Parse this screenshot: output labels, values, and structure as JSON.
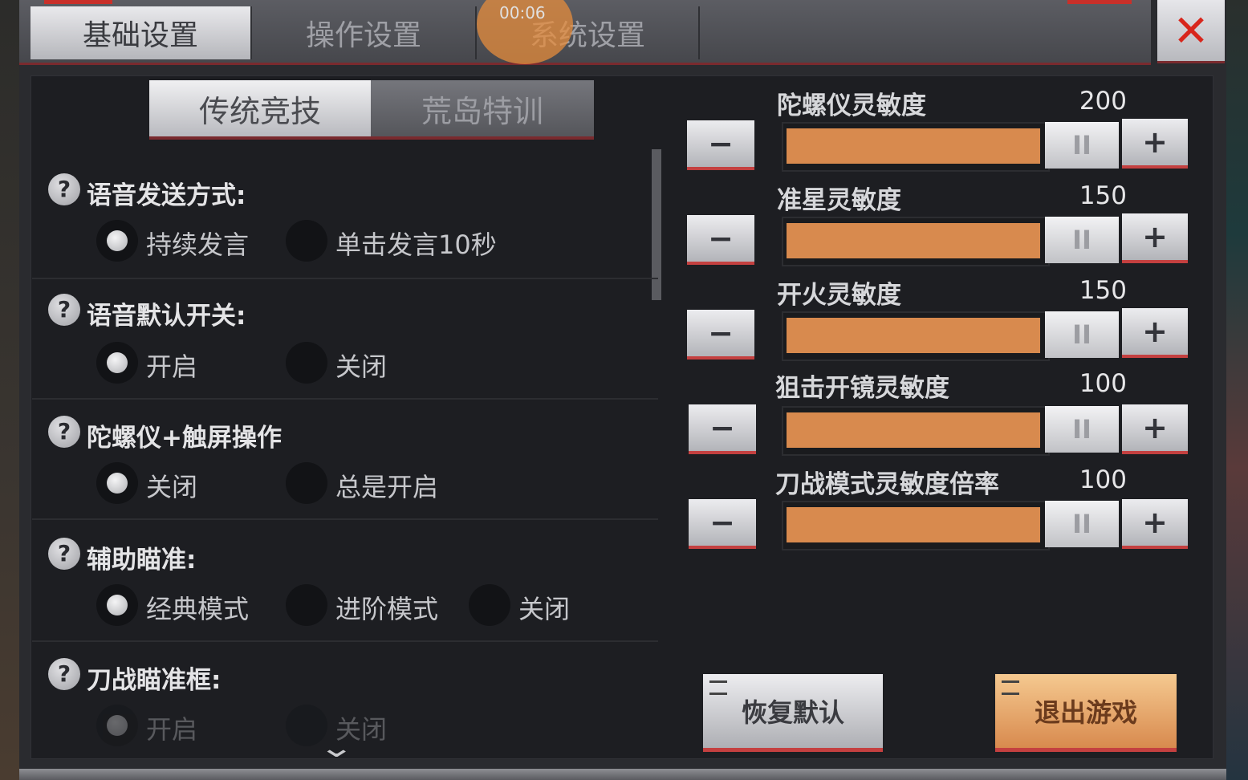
{
  "top_tabs": [
    {
      "label": "基础设置",
      "active": true
    },
    {
      "label": "操作设置",
      "active": false
    },
    {
      "label": "系统设置",
      "active": false
    }
  ],
  "timer": "00:06",
  "sub_tabs": [
    {
      "label": "传统竞技",
      "active": true
    },
    {
      "label": "荒岛特训",
      "active": false
    }
  ],
  "sections": [
    {
      "title": "语音发送方式:",
      "options": [
        "持续发言",
        "单击发言10秒"
      ],
      "selected": 0
    },
    {
      "title": "语音默认开关:",
      "options": [
        "开启",
        "关闭"
      ],
      "selected": 0
    },
    {
      "title": "陀螺仪+触屏操作",
      "options": [
        "关闭",
        "总是开启"
      ],
      "selected": 0
    },
    {
      "title": "辅助瞄准:",
      "options": [
        "经典模式",
        "进阶模式",
        "关闭"
      ],
      "selected": 0
    },
    {
      "title": "刀战瞄准框:",
      "options": [
        "开启",
        "关闭"
      ],
      "selected": 0
    }
  ],
  "sliders": [
    {
      "label": "陀螺仪灵敏度",
      "value": "200",
      "fill": 0.98
    },
    {
      "label": "准星灵敏度",
      "value": "150",
      "fill": 0.98
    },
    {
      "label": "开火灵敏度",
      "value": "150",
      "fill": 0.98
    },
    {
      "label": "狙击开镜灵敏度",
      "value": "100",
      "fill": 0.98
    },
    {
      "label": "刀战模式灵敏度倍率",
      "value": "100",
      "fill": 0.98
    }
  ],
  "buttons": {
    "reset": "恢复默认",
    "exit": "退出游戏"
  },
  "icons": {
    "minus": "−",
    "plus": "+",
    "thumb": "II",
    "question": "?",
    "close": "✕",
    "chevron": "⌄"
  },
  "colors": {
    "fill": "#d88a4e",
    "accent_red": "#c44040"
  }
}
